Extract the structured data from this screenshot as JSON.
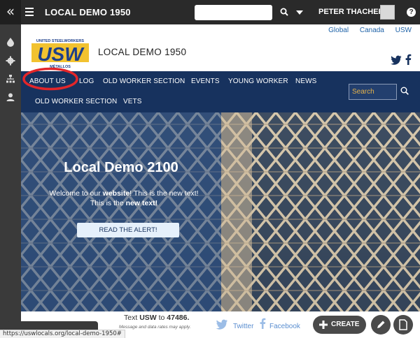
{
  "topbar": {
    "title": "LOCAL DEMO 1950",
    "user": "PETER THACHER",
    "collapse_glyph": "«",
    "help_glyph": "?"
  },
  "rail_icons": [
    "drop-icon",
    "gear-icon",
    "sitemap-icon",
    "user-icon"
  ],
  "site": {
    "top_links": [
      "Global",
      "Canada",
      "USW"
    ],
    "title": "LOCAL DEMO 1950",
    "logo_text": "USW",
    "logo_top_text": "UNITED STEELWORKERS",
    "logo_bottom_text": "MÉTALLOS",
    "nav_items": [
      {
        "label": "ABOUT US"
      },
      {
        "label": "LOG"
      },
      {
        "label": "OLD WORKER SECTION"
      },
      {
        "label": "EVENTS"
      },
      {
        "label": "YOUNG WORKER"
      },
      {
        "label": "NEWS"
      },
      {
        "label": "OLD WORKER SECTION"
      },
      {
        "label": "VETS"
      }
    ],
    "nav_search_placeholder": "Search"
  },
  "hero": {
    "heading": "Local Demo 2100",
    "intro_pre": "Welcome to our ",
    "intro_bold1": "website",
    "intro_mid": "! This is the new text! This is the ",
    "intro_bold2": "new text!",
    "button": "READ THE ALERT!"
  },
  "footer": {
    "text_pre": "Text ",
    "text_usw": "USW",
    "text_mid": " to ",
    "text_number": "47486.",
    "disclaimer": "Message and data rates may apply.",
    "twitter": "Twitter",
    "facebook": "Facebook",
    "create": "CREATE"
  },
  "status_url": "https://uswlocals.org/local-demo-1950#",
  "colors": {
    "nav_bg": "#17325e",
    "link": "#1f63a8",
    "annotation_circle": "#e3262a"
  }
}
